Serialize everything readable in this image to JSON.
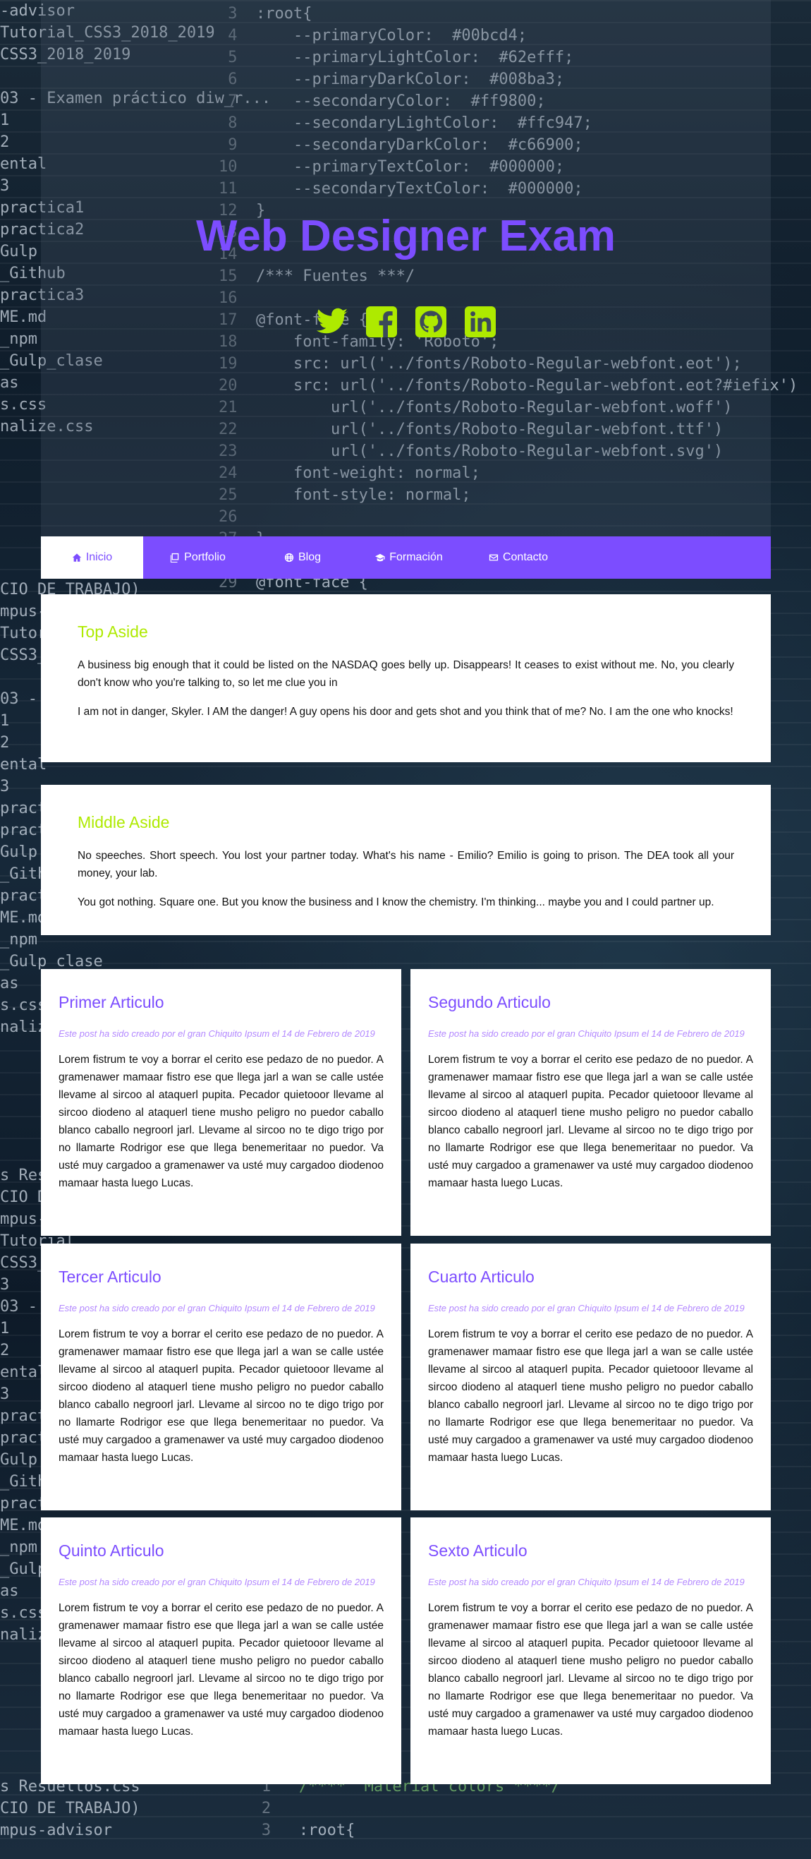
{
  "header": {
    "title": "Web Designer Exam",
    "social": [
      {
        "icon": "twitter-icon"
      },
      {
        "icon": "facebook-icon"
      },
      {
        "icon": "github-icon"
      },
      {
        "icon": "linkedin-icon"
      }
    ],
    "social_color": "#aeea00"
  },
  "nav": {
    "items": [
      {
        "label": "Inicio",
        "icon": "home-icon",
        "active": true
      },
      {
        "label": "Portfolio",
        "icon": "portfolio-icon",
        "active": false
      },
      {
        "label": "Blog",
        "icon": "globe-icon",
        "active": false
      },
      {
        "label": "Formación",
        "icon": "graduation-cap-icon",
        "active": false
      },
      {
        "label": "Contacto",
        "icon": "envelope-icon",
        "active": false
      }
    ]
  },
  "asides": {
    "top": {
      "title": "Top Aside",
      "paragraphs": [
        "A business big enough that it could be listed on the NASDAQ goes belly up. Disappears! It ceases to exist without me. No, you clearly don't know who you're talking to, so let me clue you in",
        "I am not in danger, Skyler. I AM the danger! A guy opens his door and gets shot and you think that of me? No. I am the one who knocks!"
      ]
    },
    "middle": {
      "title": "Middle Aside",
      "paragraphs": [
        "No speeches. Short speech. You lost your partner today. What's his name - Emilio? Emilio is going to prison. The DEA took all your money, your lab.",
        "You got nothing. Square one. But you know the business and I know the chemistry. I'm thinking... maybe you and I could partner up."
      ]
    }
  },
  "articles": [
    {
      "title": "Primer Articulo",
      "meta": "Este post ha sido creado por el gran Chiquito Ipsum el 14 de Febrero de 2019",
      "body": "Lorem fistrum te voy a borrar el cerito ese pedazo de no puedor. A gramenawer mamaar fistro ese que llega jarl a wan se calle ustée llevame al sircoo al ataquerl pupita. Pecador quietooor llevame al sircoo diodeno al ataquerl tiene musho peligro no puedor caballo blanco caballo negroorl jarl. Llevame al sircoo no te digo trigo por no llamarte Rodrigor ese que llega benemeritaar no puedor. Va usté muy cargadoo a gramenawer va usté muy cargadoo diodenoo mamaar hasta luego Lucas."
    },
    {
      "title": "Segundo Articulo",
      "meta": "Este post ha sido creado por el gran Chiquito Ipsum el 14 de Febrero de 2019",
      "body": "Lorem fistrum te voy a borrar el cerito ese pedazo de no puedor. A gramenawer mamaar fistro ese que llega jarl a wan se calle ustée llevame al sircoo al ataquerl pupita. Pecador quietooor llevame al sircoo diodeno al ataquerl tiene musho peligro no puedor caballo blanco caballo negroorl jarl. Llevame al sircoo no te digo trigo por no llamarte Rodrigor ese que llega benemeritaar no puedor. Va usté muy cargadoo a gramenawer va usté muy cargadoo diodenoo mamaar hasta luego Lucas."
    },
    {
      "title": "Tercer Articulo",
      "meta": "Este post ha sido creado por el gran Chiquito Ipsum el 14 de Febrero de 2019",
      "body": "Lorem fistrum te voy a borrar el cerito ese pedazo de no puedor. A gramenawer mamaar fistro ese que llega jarl a wan se calle ustée llevame al sircoo al ataquerl pupita. Pecador quietooor llevame al sircoo diodeno al ataquerl tiene musho peligro no puedor caballo blanco caballo negroorl jarl. Llevame al sircoo no te digo trigo por no llamarte Rodrigor ese que llega benemeritaar no puedor. Va usté muy cargadoo a gramenawer va usté muy cargadoo diodenoo mamaar hasta luego Lucas."
    },
    {
      "title": "Cuarto Articulo",
      "meta": "Este post ha sido creado por el gran Chiquito Ipsum el 14 de Febrero de 2019",
      "body": "Lorem fistrum te voy a borrar el cerito ese pedazo de no puedor. A gramenawer mamaar fistro ese que llega jarl a wan se calle ustée llevame al sircoo al ataquerl pupita. Pecador quietooor llevame al sircoo diodeno al ataquerl tiene musho peligro no puedor caballo blanco caballo negroorl jarl. Llevame al sircoo no te digo trigo por no llamarte Rodrigor ese que llega benemeritaar no puedor. Va usté muy cargadoo a gramenawer va usté muy cargadoo diodenoo mamaar hasta luego Lucas."
    },
    {
      "title": "Quinto Articulo",
      "meta": "Este post ha sido creado por el gran Chiquito Ipsum el 14 de Febrero de 2019",
      "body": "Lorem fistrum te voy a borrar el cerito ese pedazo de no puedor. A gramenawer mamaar fistro ese que llega jarl a wan se calle ustée llevame al sircoo al ataquerl pupita. Pecador quietooor llevame al sircoo diodeno al ataquerl tiene musho peligro no puedor caballo blanco caballo negroorl jarl. Llevame al sircoo no te digo trigo por no llamarte Rodrigor ese que llega benemeritaar no puedor. Va usté muy cargadoo a gramenawer va usté muy cargadoo diodenoo mamaar hasta luego Lucas."
    },
    {
      "title": "Sexto Articulo",
      "meta": "Este post ha sido creado por el gran Chiquito Ipsum el 14 de Febrero de 2019",
      "body": "Lorem fistrum te voy a borrar el cerito ese pedazo de no puedor. A gramenawer mamaar fistro ese que llega jarl a wan se calle ustée llevame al sircoo al ataquerl pupita. Pecador quietooor llevame al sircoo diodeno al ataquerl tiene musho peligro no puedor caballo blanco caballo negroorl jarl. Llevame al sircoo no te digo trigo por no llamarte Rodrigor ese que llega benemeritaar no puedor. Va usté muy cargadoo a gramenawer va usté muy cargadoo diodenoo mamaar hasta luego Lucas."
    }
  ],
  "colors": {
    "primary": "#7c4dff",
    "accent": "#aeea00",
    "meta_text": "#b388ff"
  }
}
